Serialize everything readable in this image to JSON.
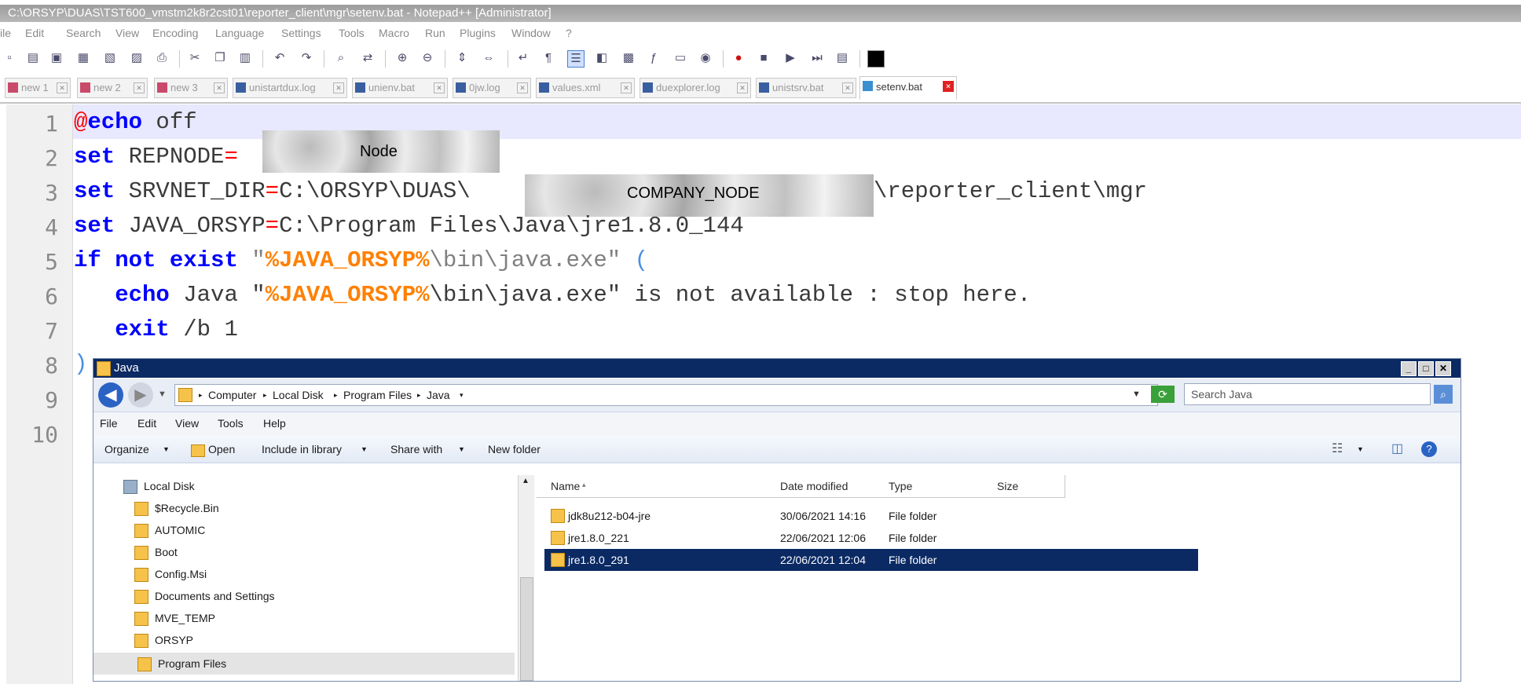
{
  "npp": {
    "title": "C:\\ORSYP\\DUAS\\TST600_vmstm2k8r2cst01\\reporter_client\\mgr\\setenv.bat - Notepad++ [Administrator]",
    "menu": [
      "ile",
      "Edit",
      "Search",
      "View",
      "Encoding",
      "Language",
      "Settings",
      "Tools",
      "Macro",
      "Run",
      "Plugins",
      "Window",
      "?"
    ],
    "toolbar_icons": [
      "new-icon",
      "open-icon",
      "save-icon",
      "save-all-icon",
      "close-icon",
      "close-all-icon",
      "print-icon",
      "cut-icon",
      "copy-icon",
      "paste-icon",
      "undo-icon",
      "redo-icon",
      "find-icon",
      "replace-icon",
      "zoom-in-icon",
      "zoom-out-icon",
      "sync-v-icon",
      "sync-h-icon",
      "wrap-icon",
      "all-chars-icon",
      "indent-guide-icon",
      "udl-icon",
      "doc-map-icon",
      "function-list-icon",
      "folder-workspace-icon",
      "monitor-icon",
      "record-icon",
      "stop-icon",
      "play-icon",
      "run-multiple-icon",
      "save-macro-icon",
      "black-square-icon"
    ],
    "tabs": [
      {
        "label": "new 1",
        "color": "#c94a6a"
      },
      {
        "label": "new 2",
        "color": "#c94a6a"
      },
      {
        "label": "new 3",
        "color": "#c94a6a"
      },
      {
        "label": "unistartdux.log",
        "color": "#3a5fa0"
      },
      {
        "label": "unienv.bat",
        "color": "#3a5fa0"
      },
      {
        "label": "0jw.log",
        "color": "#3a5fa0"
      },
      {
        "label": "values.xml",
        "color": "#3a5fa0"
      },
      {
        "label": "duexplorer.log",
        "color": "#3a5fa0"
      },
      {
        "label": "unistsrv.bat",
        "color": "#3a5fa0"
      },
      {
        "label": "setenv.bat",
        "color": "#3a8fd0",
        "active": true
      }
    ],
    "line_numbers": [
      "1",
      "2",
      "3",
      "4",
      "5",
      "6",
      "7",
      "8",
      "9",
      "10"
    ],
    "code": {
      "l1": {
        "at": "@",
        "kw": "echo",
        "rest": " off"
      },
      "l2": {
        "kw": "set",
        "rest": " REPNODE",
        "op": "=",
        "redacted": "Node"
      },
      "l3": {
        "kw": "set",
        "rest": " SRVNET_DIR",
        "op": "=",
        "path": "C:\\ORSYP\\DUAS\\",
        "redacted": "COMPANY_NODE",
        "tail": "\\reporter_client\\mgr"
      },
      "l4": {
        "kw": "set",
        "rest": " JAVA_ORSYP",
        "op": "=",
        "path": "C:\\Program Files\\Java\\jre1.8.0_144"
      },
      "l5": {
        "kw1": "if",
        "kw2": "not",
        "kw3": "exist",
        "q1": " \"",
        "var": "%JAVA_ORSYP%",
        "q2": "\\bin\\java.exe\" ",
        "paren": "("
      },
      "l6": {
        "kw": "echo",
        "rest": " Java \"",
        "var": "%JAVA_ORSYP%",
        "rest2": "\\bin\\java.exe\" is not available : stop here."
      },
      "l7": {
        "kw": "exit",
        "rest": " /b 1"
      },
      "l8": {
        "paren": ")"
      }
    }
  },
  "explorer": {
    "title": "Java",
    "breadcrumb": [
      "Computer",
      "Local Disk",
      "Program Files",
      "Java"
    ],
    "search_placeholder": "Search Java",
    "menubar": [
      "File",
      "Edit",
      "View",
      "Tools",
      "Help"
    ],
    "commands": {
      "organize": "Organize",
      "open": "Open",
      "include": "Include in library",
      "share": "Share with",
      "new_folder": "New folder"
    },
    "nav_tree": [
      {
        "label": "Local Disk"
      },
      {
        "label": "$Recycle.Bin"
      },
      {
        "label": "AUTOMIC"
      },
      {
        "label": "Boot"
      },
      {
        "label": "Config.Msi"
      },
      {
        "label": "Documents and Settings"
      },
      {
        "label": "MVE_TEMP"
      },
      {
        "label": "ORSYP"
      },
      {
        "label": "Program Files",
        "selected": true
      }
    ],
    "columns": {
      "name": "Name",
      "date": "Date modified",
      "type": "Type",
      "size": "Size"
    },
    "files": [
      {
        "name": "jdk8u212-b04-jre",
        "date": "30/06/2021 14:16",
        "type": "File folder"
      },
      {
        "name": "jre1.8.0_221",
        "date": "22/06/2021 12:06",
        "type": "File folder"
      },
      {
        "name": "jre1.8.0_291",
        "date": "22/06/2021 12:04",
        "type": "File folder",
        "selected": true
      }
    ]
  }
}
